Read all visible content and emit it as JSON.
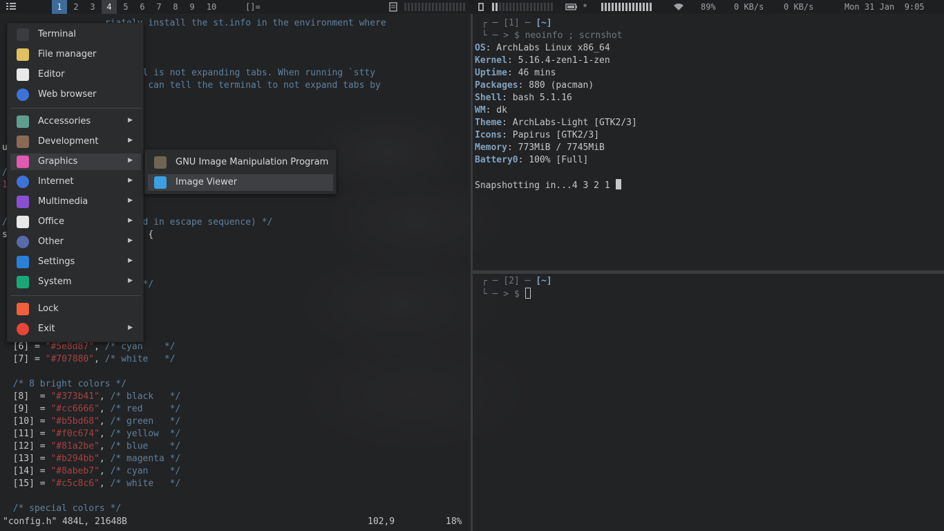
{
  "bar": {
    "menu_icon": "grid-menu-icon",
    "workspaces": [
      "1",
      "2",
      "3",
      "4",
      "5",
      "6",
      "7",
      "8",
      "9",
      "10"
    ],
    "active_workspace": "1",
    "occupied_workspace": "4",
    "layout_symbol": "[]=",
    "cpu_icon": "cpu-icon",
    "mem_icon": "memory-icon",
    "battery_icon": "battery-icon",
    "charging_glyph": "*",
    "wifi_icon": "wifi-icon",
    "wifi_strength": "89%",
    "net_down": "0 KB/s",
    "net_up": "0 KB/s",
    "datetime": "Mon 31 Jan  9:05"
  },
  "editor": {
    "lines": [
      {
        "parts": [
          {
            "t": "                   ",
            "c": ""
          },
          {
            "t": "riately install the st.info in the environment where",
            "c": "cm"
          }
        ]
      },
      {
        "parts": [
          {
            "t": "                   ",
            "c": ""
          },
          {
            "t": "n.",
            "c": "cm"
          }
        ]
      },
      {
        "parts": [
          {
            "t": "",
            "c": ""
          }
        ]
      },
      {
        "parts": [
          {
            "t": "",
            "c": ""
          }
        ]
      },
      {
        "parts": [
          {
            "t": "                   ",
            "c": ""
          },
          {
            "t": "r kernel is not expanding tabs. When running `stty",
            "c": "cm"
          }
        ]
      },
      {
        "parts": [
          {
            "t": "                   ",
            "c": ""
          },
          {
            "t": "ar. You can tell the terminal to not expand tabs by",
            "c": "cm"
          }
        ]
      },
      {
        "parts": [
          {
            "t": "                   ",
            "c": ""
          },
          {
            "t": "mand:",
            "c": "cm"
          }
        ]
      },
      {
        "parts": [
          {
            "t": "",
            "c": ""
          }
        ]
      },
      {
        "parts": [
          {
            "t": "",
            "c": ""
          }
        ]
      },
      {
        "parts": [
          {
            "t": "",
            "c": ""
          }
        ]
      },
      {
        "parts": [
          {
            "t": "u",
            "c": "br"
          }
        ]
      },
      {
        "parts": [
          {
            "t": "",
            "c": ""
          }
        ]
      },
      {
        "parts": [
          {
            "t": "/",
            "c": "cm"
          }
        ]
      },
      {
        "parts": [
          {
            "t": "1",
            "c": "str"
          }
        ]
      },
      {
        "parts": [
          {
            "t": "",
            "c": ""
          }
        ]
      },
      {
        "parts": [
          {
            "t": "",
            "c": ""
          }
        ]
      },
      {
        "parts": [
          {
            "t": "/",
            "c": "cm"
          },
          {
            "t": "                  ",
            "c": ""
          },
          {
            "t": "rst used in escape sequence) */",
            "c": "cm"
          }
        ]
      },
      {
        "parts": [
          {
            "t": "s",
            "c": "br"
          },
          {
            "t": "                  ",
            "c": ""
          },
          {
            "t": "ame[] = {",
            "c": "br"
          }
        ]
      },
      {
        "parts": [
          {
            "t": "",
            "c": ""
          }
        ]
      },
      {
        "parts": [
          {
            "t": "",
            "c": ""
          }
        ]
      },
      {
        "parts": [
          {
            "t": "                   ",
            "c": ""
          },
          {
            "t": "ck   */",
            "c": "cm"
          }
        ]
      },
      {
        "parts": [
          {
            "t": "                          ",
            "c": ""
          },
          {
            "t": "*/",
            "c": "cm"
          }
        ]
      },
      {
        "parts": [
          {
            "t": "                   ",
            "c": ""
          },
          {
            "t": "en   */",
            "c": "cm"
          }
        ]
      },
      {
        "parts": [
          {
            "t": "                   ",
            "c": ""
          },
          {
            "t": "low  */",
            "c": "cm"
          }
        ]
      },
      {
        "parts": [
          {
            "t": "                   ",
            "c": ""
          },
          {
            "t": "e    */",
            "c": "cm"
          }
        ]
      },
      {
        "parts": [
          {
            "t": "                   ",
            "c": ""
          },
          {
            "t": "enta */",
            "c": "cm"
          }
        ]
      },
      {
        "parts": [
          {
            "t": "  [6] = ",
            "c": "br"
          },
          {
            "t": "\"#5e8d87\"",
            "c": "str"
          },
          {
            "t": ", ",
            "c": "br"
          },
          {
            "t": "/* cyan    */",
            "c": "cm"
          }
        ]
      },
      {
        "parts": [
          {
            "t": "  [7] = ",
            "c": "br"
          },
          {
            "t": "\"#707880\"",
            "c": "str"
          },
          {
            "t": ", ",
            "c": "br"
          },
          {
            "t": "/* white   */",
            "c": "cm"
          }
        ]
      },
      {
        "parts": [
          {
            "t": "",
            "c": ""
          }
        ]
      },
      {
        "parts": [
          {
            "t": "  ",
            "c": ""
          },
          {
            "t": "/* 8 bright colors */",
            "c": "cm"
          }
        ]
      },
      {
        "parts": [
          {
            "t": "  [8]  = ",
            "c": "br"
          },
          {
            "t": "\"#373b41\"",
            "c": "str"
          },
          {
            "t": ", ",
            "c": "br"
          },
          {
            "t": "/* black   */",
            "c": "cm"
          }
        ]
      },
      {
        "parts": [
          {
            "t": "  [9]  = ",
            "c": "br"
          },
          {
            "t": "\"#cc6666\"",
            "c": "str"
          },
          {
            "t": ", ",
            "c": "br"
          },
          {
            "t": "/* red     */",
            "c": "cm"
          }
        ]
      },
      {
        "parts": [
          {
            "t": "  [10] = ",
            "c": "br"
          },
          {
            "t": "\"#b5bd68\"",
            "c": "str"
          },
          {
            "t": ", ",
            "c": "br"
          },
          {
            "t": "/* green   */",
            "c": "cm"
          }
        ]
      },
      {
        "parts": [
          {
            "t": "  [11] = ",
            "c": "br"
          },
          {
            "t": "\"#f0c674\"",
            "c": "str"
          },
          {
            "t": ", ",
            "c": "br"
          },
          {
            "t": "/* yellow  */",
            "c": "cm"
          }
        ]
      },
      {
        "parts": [
          {
            "t": "  [12] = ",
            "c": "br"
          },
          {
            "t": "\"#81a2be\"",
            "c": "str"
          },
          {
            "t": ", ",
            "c": "br"
          },
          {
            "t": "/* blue    */",
            "c": "cm"
          }
        ]
      },
      {
        "parts": [
          {
            "t": "  [13] = ",
            "c": "br"
          },
          {
            "t": "\"#b294bb\"",
            "c": "str"
          },
          {
            "t": ", ",
            "c": "br"
          },
          {
            "t": "/* magenta */",
            "c": "cm"
          }
        ]
      },
      {
        "parts": [
          {
            "t": "  [14] = ",
            "c": "br"
          },
          {
            "t": "\"#8abeb7\"",
            "c": "str"
          },
          {
            "t": ", ",
            "c": "br"
          },
          {
            "t": "/* cyan    */",
            "c": "cm"
          }
        ]
      },
      {
        "parts": [
          {
            "t": "  [15] = ",
            "c": "br"
          },
          {
            "t": "\"#c5c8c6\"",
            "c": "str"
          },
          {
            "t": ", ",
            "c": "br"
          },
          {
            "t": "/* white   */",
            "c": "cm"
          }
        ]
      },
      {
        "parts": [
          {
            "t": "",
            "c": ""
          }
        ]
      },
      {
        "parts": [
          {
            "t": "  ",
            "c": ""
          },
          {
            "t": "/* special colors */",
            "c": "cm"
          }
        ]
      }
    ],
    "status_file": "\"config.h\" 484L, 21648B",
    "status_pos": "102,9",
    "status_pct": "18%"
  },
  "term1": {
    "prompt1_a": "┌ ─ [1] ─ ",
    "prompt1_b": "[~]",
    "prompt2": "└ ─ > $ ",
    "command": "neoinfo ; scrnshot",
    "info": [
      {
        "k": "OS",
        "v": ": ArchLabs Linux x86_64"
      },
      {
        "k": "Kernel",
        "v": ": 5.16.4-zen1-1-zen"
      },
      {
        "k": "Uptime",
        "v": ": 46 mins"
      },
      {
        "k": "Packages",
        "v": ": 880 (pacman)"
      },
      {
        "k": "Shell",
        "v": ": bash 5.1.16"
      },
      {
        "k": "WM",
        "v": ": dk"
      },
      {
        "k": "Theme",
        "v": ": ArchLabs-Light [GTK2/3]"
      },
      {
        "k": "Icons",
        "v": ": Papirus [GTK2/3]"
      },
      {
        "k": "Memory",
        "v": ": 773MiB / 7745MiB"
      },
      {
        "k": "Battery0",
        "v": ": 100% [Full]"
      }
    ],
    "snapshot": "Snapshotting in...4 3 2 1 "
  },
  "term2": {
    "prompt1_a": "┌ ─ [2] ─ ",
    "prompt1_b": "[~]",
    "prompt2": "└ ─ > $ "
  },
  "menu": {
    "items": [
      {
        "label": "Terminal",
        "icon": "terminal-icon",
        "color": "#3a3c40",
        "sub": false
      },
      {
        "label": "File manager",
        "icon": "folder-icon",
        "color": "#e0c060",
        "sub": false
      },
      {
        "label": "Editor",
        "icon": "text-editor-icon",
        "color": "#e8e8e8",
        "sub": false
      },
      {
        "label": "Web browser",
        "icon": "web-browser-icon",
        "color": "#3d73d9",
        "sub": false
      },
      {
        "label": "Accessories",
        "icon": "accessories-icon",
        "color": "#5e9e8f",
        "sub": true
      },
      {
        "label": "Development",
        "icon": "development-icon",
        "color": "#8a6a55",
        "sub": true
      },
      {
        "label": "Graphics",
        "icon": "graphics-icon",
        "color": "#e05ab0",
        "sub": true
      },
      {
        "label": "Internet",
        "icon": "internet-icon",
        "color": "#3d73d9",
        "sub": true
      },
      {
        "label": "Multimedia",
        "icon": "multimedia-icon",
        "color": "#8a4fd0",
        "sub": true
      },
      {
        "label": "Office",
        "icon": "office-icon",
        "color": "#e8e8e8",
        "sub": true
      },
      {
        "label": "Other",
        "icon": "other-icon",
        "color": "#5a6aa8",
        "sub": true
      },
      {
        "label": "Settings",
        "icon": "settings-icon",
        "color": "#2a7fd8",
        "sub": true
      },
      {
        "label": "System",
        "icon": "system-icon",
        "color": "#18a878",
        "sub": true
      },
      {
        "label": "Lock",
        "icon": "lock-icon",
        "color": "#f0603a",
        "sub": false
      },
      {
        "label": "Exit",
        "icon": "power-icon",
        "color": "#e8453a",
        "sub": true
      }
    ],
    "submenu": [
      {
        "label": "GNU Image Manipulation Program",
        "icon": "gimp-icon",
        "color": "#6e6553"
      },
      {
        "label": "Image Viewer",
        "icon": "image-viewer-icon",
        "color": "#3aa0e0"
      }
    ]
  }
}
